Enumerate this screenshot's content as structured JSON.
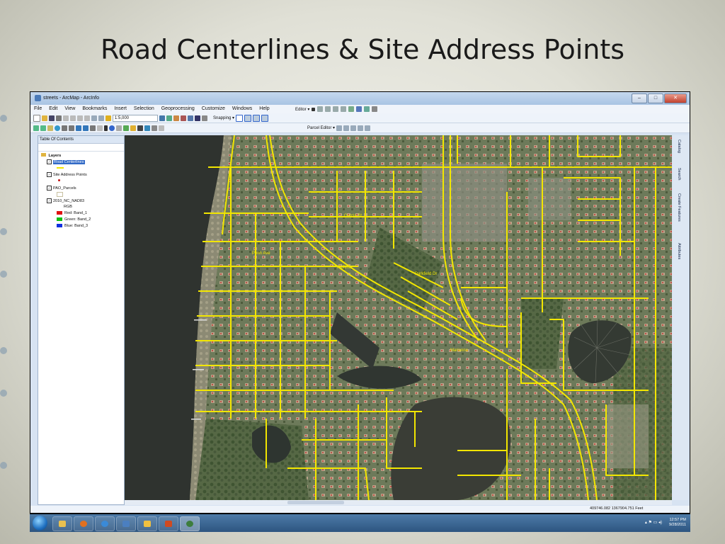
{
  "slide": {
    "title": "Road Centerlines & Site Address Points"
  },
  "window": {
    "title": "streets - ArcMap - ArcInfo",
    "buttons": [
      "–",
      "□",
      "✕"
    ]
  },
  "menu": [
    "File",
    "Edit",
    "View",
    "Bookmarks",
    "Insert",
    "Selection",
    "Geoprocessing",
    "Customize",
    "Windows",
    "Help"
  ],
  "toolbar": {
    "editor_label": "Editor ▾",
    "scale_value": "1:5,000",
    "snapping_label": "Snapping ▾",
    "parcel_editor_label": "Parcel Editor ▾"
  },
  "toc": {
    "title": "Table Of Contents",
    "root": "Layers",
    "layers": [
      {
        "name": "Road Centerlines",
        "checked": true,
        "selected": true
      },
      {
        "name": "Site Address Points",
        "checked": true
      },
      {
        "name": "PAO_Parcels",
        "checked": true
      },
      {
        "name": "2010_NC_NAD83",
        "checked": true
      }
    ],
    "rgb_label": "RGB",
    "bands": [
      {
        "label": "Red:   Band_1",
        "color": "#e01010"
      },
      {
        "label": "Green:  Band_2",
        "color": "#10c010"
      },
      {
        "label": "Blue:   Band_3",
        "color": "#1030e0"
      }
    ]
  },
  "dock_tabs": [
    "Catalog",
    "Search",
    "Create Features",
    "Attributes"
  ],
  "status": {
    "coordinates": "409746.082  1367904.751 Feet"
  },
  "taskbar": {
    "time": "12:57 PM",
    "date": "9/28/2011"
  },
  "colors": {
    "road": "#f2e600",
    "water": "#2a2e2a",
    "selection": "#3169c6"
  }
}
